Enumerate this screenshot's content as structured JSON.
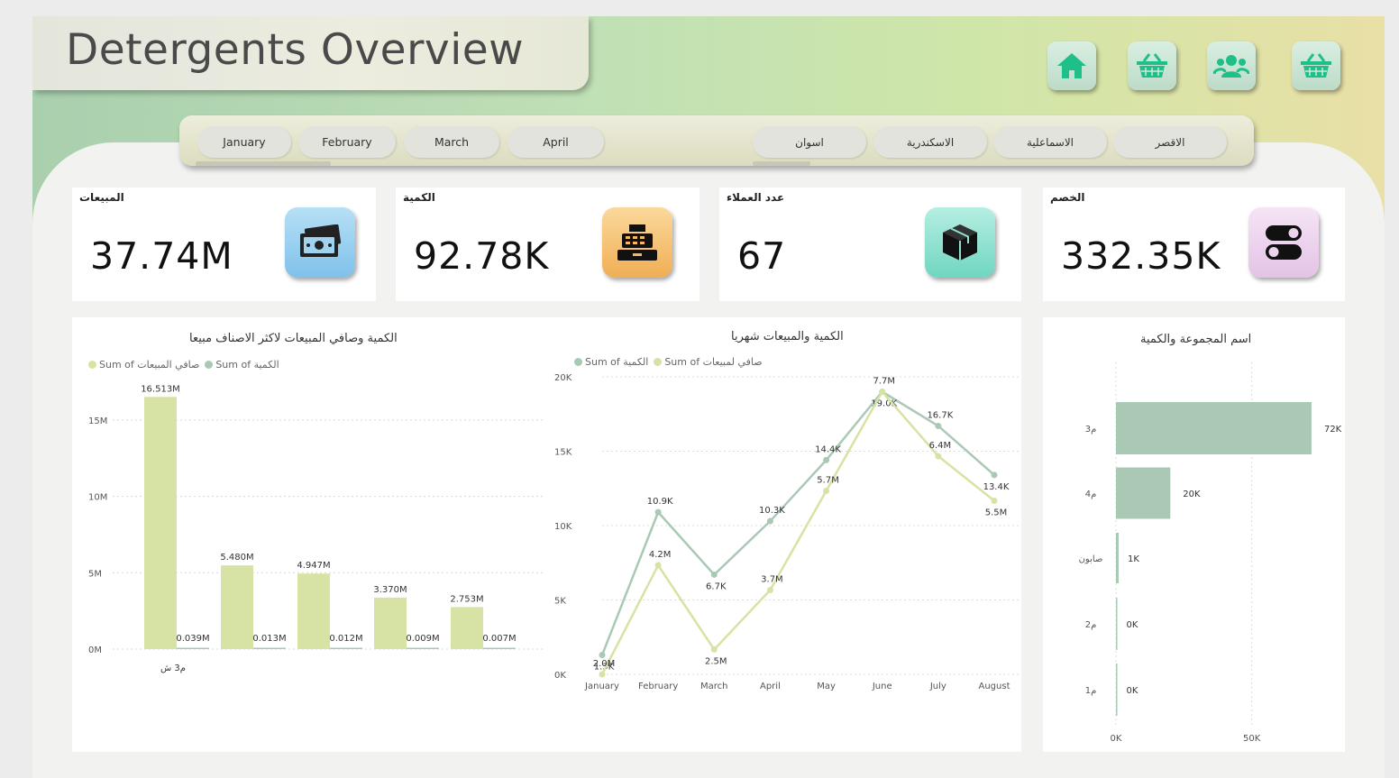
{
  "header": {
    "title": "Detergents Overview"
  },
  "nav_buttons": [
    {
      "name": "home-button",
      "icon": "home-icon"
    },
    {
      "name": "basket-button-1",
      "icon": "basket-icon"
    },
    {
      "name": "customers-button",
      "icon": "users-icon"
    },
    {
      "name": "basket-button-2",
      "icon": "basket-icon"
    }
  ],
  "slicers": {
    "months": [
      "January",
      "February",
      "March",
      "April"
    ],
    "cities": [
      "اسوان",
      "الاسكندرية",
      "الاسماعلية",
      "الاقصر"
    ]
  },
  "kpis": [
    {
      "label": "المبيعات",
      "value": "37.74M",
      "icon": "money-icon",
      "color": "#8cc9ec"
    },
    {
      "label": "الكمية",
      "value": "92.78K",
      "icon": "cash-register-icon",
      "color": "#f2b865"
    },
    {
      "label": "عدد العملاء",
      "value": "67",
      "icon": "box-icon",
      "color": "#8ee0cf"
    },
    {
      "label": "الخصم",
      "value": "332.35K",
      "icon": "toggle-icon",
      "color": "#ecd3ec"
    }
  ],
  "colors": {
    "green_light": "#d6e3a4",
    "green_gray": "#a9c9b5"
  },
  "charts": {
    "bar": {
      "title": "الكمية وصافي المبيعات لاكثر الاصناف مبيعا",
      "legend": [
        {
          "name": "Sum of صافي المبيعات",
          "color": "#d6e3a4"
        },
        {
          "name": "Sum of الكمية",
          "color": "#a9c9b5"
        }
      ]
    },
    "line": {
      "title": "الكمية والمبيعات شهريا",
      "legend": [
        {
          "name": "Sum of الكمية",
          "color": "#a9c9b5"
        },
        {
          "name": "Sum of صافي لمبيعات",
          "color": "#d6e3a4"
        }
      ]
    },
    "hbar": {
      "title": "اسم المجموعة والكمية"
    }
  },
  "chart_data": [
    {
      "type": "bar",
      "title": "الكمية وصافي المبيعات لاكثر الاصناف مبيعا",
      "categories": [
        "م3 ش",
        "",
        "",
        "",
        ""
      ],
      "series": [
        {
          "name": "Sum of صافي المبيعات",
          "values": [
            16.513,
            5.48,
            4.947,
            3.37,
            2.753
          ],
          "labels": [
            "16.513M",
            "5.480M",
            "4.947M",
            "3.370M",
            "2.753M"
          ]
        },
        {
          "name": "Sum of الكمية",
          "values": [
            0.039,
            0.013,
            0.012,
            0.009,
            0.007
          ],
          "labels": [
            "0.039M",
            "0.013M",
            "0.012M",
            "0.009M",
            "0.007M"
          ]
        }
      ],
      "ylim": [
        0,
        17
      ],
      "yticks": [
        {
          "v": 0,
          "t": "0M"
        },
        {
          "v": 5,
          "t": "5M"
        },
        {
          "v": 10,
          "t": "10M"
        },
        {
          "v": 15,
          "t": "15M"
        }
      ]
    },
    {
      "type": "line",
      "title": "الكمية والمبيعات شهريا",
      "categories": [
        "January",
        "February",
        "March",
        "April",
        "May",
        "June",
        "July",
        "August"
      ],
      "series": [
        {
          "name": "Sum of الكمية",
          "axis": "left",
          "values": [
            1.3,
            10.9,
            6.7,
            10.3,
            14.4,
            19.0,
            16.7,
            13.4
          ],
          "labels": [
            "1.3K",
            "10.9K",
            "6.7K",
            "10.3K",
            "14.4K",
            "19.0K",
            "16.7K",
            "13.4K"
          ]
        },
        {
          "name": "Sum of صافي لمبيعات",
          "axis": "right",
          "values": [
            2.0,
            4.2,
            2.5,
            3.7,
            5.7,
            7.7,
            6.4,
            5.5
          ],
          "labels": [
            "2.0M",
            "4.2M",
            "2.5M",
            "3.7M",
            "5.7M",
            "7.7M",
            "6.4M",
            "5.5M"
          ]
        }
      ],
      "y_left": {
        "lim": [
          0,
          20
        ],
        "ticks": [
          "0K",
          "5K",
          "10K",
          "15K",
          "20K"
        ]
      },
      "y_right": {
        "lim": [
          2,
          8
        ],
        "ticks": [
          "2M",
          "3M",
          "4M",
          "5M",
          "6M",
          "7M",
          "8M"
        ]
      }
    },
    {
      "type": "bar",
      "orientation": "horizontal",
      "title": "اسم المجموعة والكمية",
      "categories": [
        "م3",
        "م4",
        "صابون",
        "م2",
        "م1"
      ],
      "values": [
        72,
        20,
        1,
        0.2,
        0.1
      ],
      "labels": [
        "72K",
        "20K",
        "1K",
        "0K",
        "0K"
      ],
      "xlim": [
        0,
        75
      ],
      "xticks": [
        {
          "v": 0,
          "t": "0K"
        },
        {
          "v": 50,
          "t": "50K"
        }
      ]
    }
  ]
}
